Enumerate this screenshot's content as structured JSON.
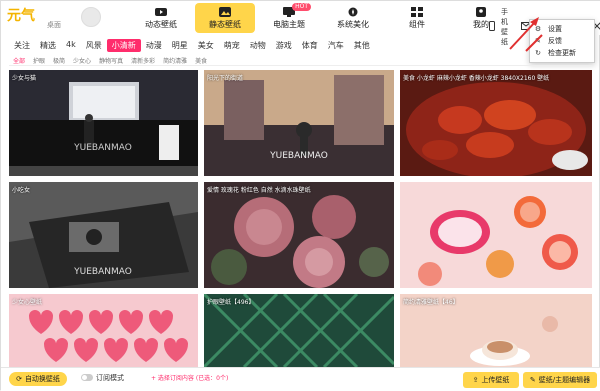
{
  "app": {
    "logo_text": "元气",
    "logo_sub": "桌面"
  },
  "nav": {
    "tabs": [
      {
        "label": "动态壁纸"
      },
      {
        "label": "静态壁纸"
      },
      {
        "label": "电脑主题",
        "badge": "HOT"
      },
      {
        "label": "系统美化"
      },
      {
        "label": "组件"
      },
      {
        "label": "我的"
      }
    ]
  },
  "topbar": {
    "phone_wallpaper": "手机壁纸"
  },
  "menu": {
    "items": [
      "设置",
      "反馈",
      "检查更新"
    ]
  },
  "categories": [
    "关注",
    "精选",
    "4k",
    "风景",
    "小清新",
    "动漫",
    "明星",
    "美女",
    "萌宠",
    "动物",
    "游戏",
    "体育",
    "汽车",
    "其他"
  ],
  "subcategories": [
    "全部",
    "护眼",
    "极简",
    "少女心",
    "静物写真",
    "清新多彩",
    "简约清雅",
    "美食"
  ],
  "cards": [
    {
      "label": "少女与猫"
    },
    {
      "label": "阳光下的街道"
    },
    {
      "label": "美食 小龙虾 麻辣小龙虾 香辣小龙虾 3840X2160 壁纸"
    },
    {
      "label": "小吃女"
    },
    {
      "label": "爱情 玫瑰花 粉红色 自然 水滴水珠壁纸"
    },
    {
      "label": ""
    },
    {
      "label": "少女心壁纸"
    },
    {
      "label": "护眼壁纸【496】"
    },
    {
      "label": "简约清雅壁纸【46】"
    }
  ],
  "watermark": "YUEBANMAO",
  "bottom": {
    "auto_label": "自动换壁纸",
    "mode_label": "订阅模式",
    "select_label": "+ 选择订阅内容 (已选：0个)",
    "upload_label": "上传壁纸",
    "editor_label": "壁纸/主题编辑器"
  },
  "colors": {
    "accent": "#ffd54a",
    "pink": "#ff2d6c"
  }
}
